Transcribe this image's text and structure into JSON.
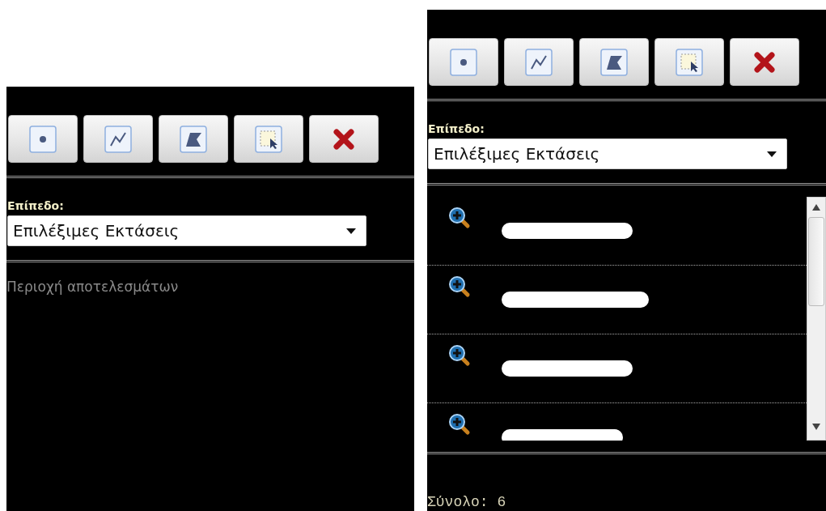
{
  "panels": [
    {
      "tools": [
        {
          "kind": "point"
        },
        {
          "kind": "line"
        },
        {
          "kind": "polygon"
        },
        {
          "kind": "select"
        },
        {
          "kind": "clear"
        }
      ],
      "layer_label": "Επίπεδο:",
      "layer_select": {
        "value": "Επιλέξιμες Εκτάσεις"
      },
      "results": {
        "empty_text": "Περιοχή αποτελεσμάτων"
      }
    },
    {
      "tools": [
        {
          "kind": "point"
        },
        {
          "kind": "line"
        },
        {
          "kind": "polygon"
        },
        {
          "kind": "select"
        },
        {
          "kind": "clear"
        }
      ],
      "layer_label": "Επίπεδο:",
      "layer_select": {
        "value": "Επιλέξιμες Εκτάσεις"
      },
      "results": {
        "items": [
          {
            "kind": "result"
          },
          {
            "kind": "result"
          },
          {
            "kind": "result"
          },
          {
            "kind": "result"
          }
        ]
      },
      "total": "Σύνολο: 6"
    }
  ]
}
